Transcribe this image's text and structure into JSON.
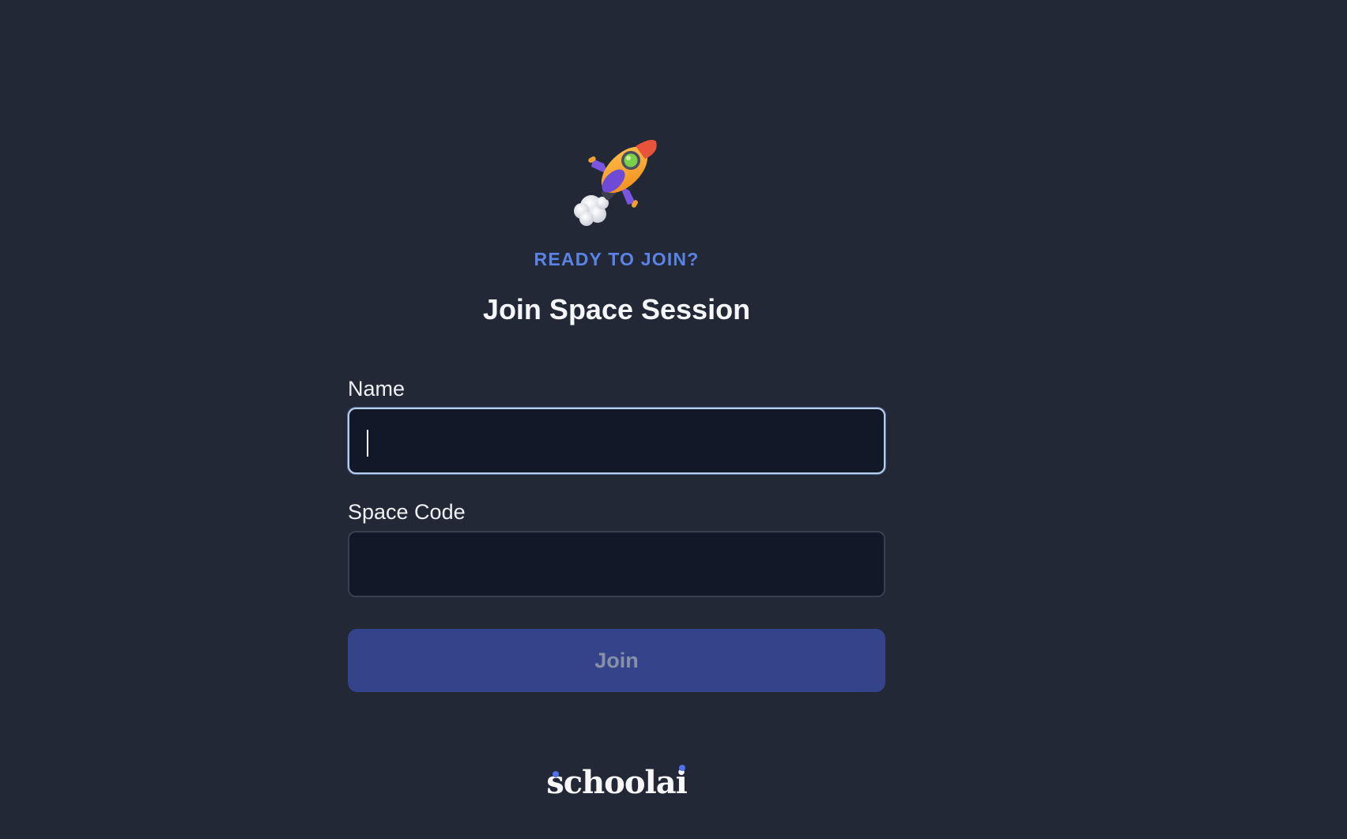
{
  "hero": {
    "icon": "rocket-icon",
    "eyebrow": "READY TO JOIN?",
    "title": "Join Space Session"
  },
  "form": {
    "name_label": "Name",
    "name_value": "",
    "name_placeholder": "",
    "space_code_label": "Space Code",
    "space_code_value": "",
    "space_code_placeholder": "",
    "join_label": "Join"
  },
  "brand": {
    "logo_text": "schoolai"
  },
  "colors": {
    "background": "#222836",
    "accent": "#5a83e6",
    "input_background": "#111827",
    "button_background": "#35448a",
    "button_text": "#8890a8",
    "logo_dot": "#4f6ff0"
  }
}
